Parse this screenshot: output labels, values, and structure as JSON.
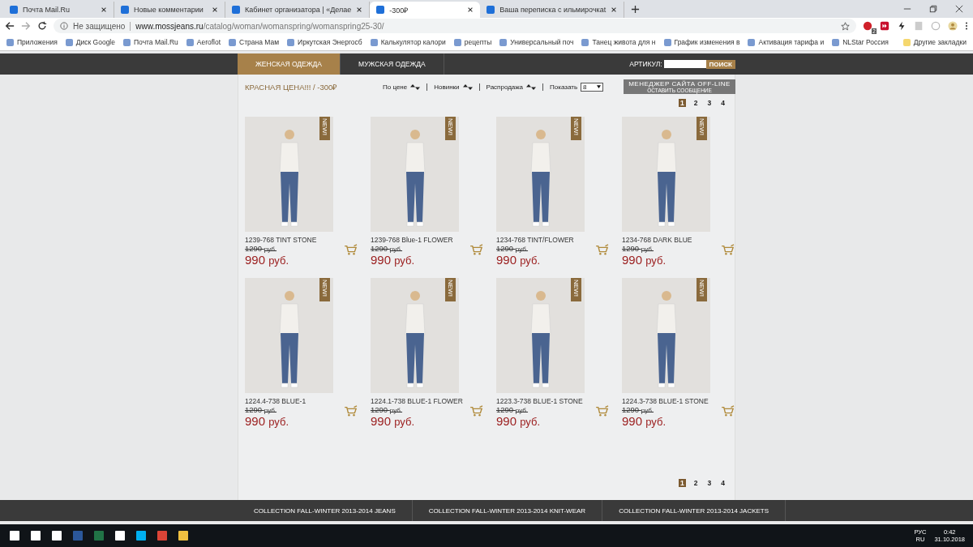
{
  "browser": {
    "tabs": [
      {
        "title": "Почта Mail.Ru",
        "selected": false
      },
      {
        "title": "Новые комментарии",
        "selected": false
      },
      {
        "title": "Кабинет организатора | «Делае",
        "selected": false
      },
      {
        "title": "-300₽",
        "selected": true
      },
      {
        "title": "Ваша переписка с ильмирочкаt",
        "selected": false
      }
    ],
    "security": "Не защищено",
    "url_host": "www.mossjeans.ru",
    "url_path": "/catalog/woman/womanspring/womanspring25-30/",
    "bookmarks": [
      "Приложения",
      "Диск Google",
      "Почта Mail.Ru",
      "Aeroflot",
      "Страна Мам",
      "Иркутская Энергосб",
      "Калькулятор калори",
      "рецепты",
      "Универсальный поч",
      "Танец живота для н",
      "График изменения в",
      "Активация тарифа и",
      "NLStar Россия"
    ],
    "other_bookmarks": "Другие закладки",
    "extension_badge": "2"
  },
  "site": {
    "nav": [
      {
        "label": "ЖЕНСКАЯ ОДЕЖДА",
        "selected": true
      },
      {
        "label": "МУЖСКАЯ ОДЕЖДА",
        "selected": false
      }
    ],
    "article_label": "АРТИКУЛ:",
    "search_button": "ПОИСК",
    "heading": "КРАСНАЯ ЦЕНА!!! / -300₽",
    "sort": [
      "По цене",
      "Новинки",
      "Распродажа"
    ],
    "show_label": "Показать",
    "show_value": "8",
    "manager": {
      "title": "МЕНЕДЖЕР САЙТА OFF-LINE",
      "subtitle": "ОСТАВИТЬ СООБЩЕНИЕ"
    },
    "pages": [
      {
        "label": "1",
        "selected": true
      },
      {
        "label": "2",
        "selected": false
      },
      {
        "label": "3",
        "selected": false
      },
      {
        "label": "4",
        "selected": false
      }
    ],
    "bottom_pages": [
      {
        "label": "1",
        "selected": true
      },
      {
        "label": "2",
        "selected": false
      },
      {
        "label": "3",
        "selected": false
      },
      {
        "label": "4",
        "selected": false
      }
    ],
    "products": [
      {
        "name": "1239-768 TINT STONE",
        "old_price": "1290",
        "old_unit": "руб.",
        "price": "990",
        "unit": "руб.",
        "badge": "NEW!"
      },
      {
        "name": "1239-768 Blue-1 FLOWER",
        "old_price": "1290",
        "old_unit": "руб.",
        "price": "990",
        "unit": "руб.",
        "badge": "NEW!"
      },
      {
        "name": "1234-768 TINT/FLOWER",
        "old_price": "1290",
        "old_unit": "руб.",
        "price": "990",
        "unit": "руб.",
        "badge": "NEW!"
      },
      {
        "name": "1234-768 DARK BLUE",
        "old_price": "1290",
        "old_unit": "руб.",
        "price": "990",
        "unit": "руб.",
        "badge": "NEW!"
      },
      {
        "name": "1224.4-738 BLUE-1",
        "old_price": "1290",
        "old_unit": "руб.",
        "price": "990",
        "unit": "руб.",
        "badge": "NEW!"
      },
      {
        "name": "1224.1-738 BLUE-1 FLOWER",
        "old_price": "1290",
        "old_unit": "руб.",
        "price": "990",
        "unit": "руб.",
        "badge": "NEW!"
      },
      {
        "name": "1223.3-738 BLUE-1 STONE",
        "old_price": "1290",
        "old_unit": "руб.",
        "price": "990",
        "unit": "руб.",
        "badge": "NEW!"
      },
      {
        "name": "1224.3-738 BLUE-1 STONE",
        "old_price": "1290",
        "old_unit": "руб.",
        "price": "990",
        "unit": "руб.",
        "badge": "NEW!"
      }
    ],
    "footer_links": [
      "COLLECTION FALL-WINTER 2013-2014 JEANS",
      "COLLECTION FALL-WINTER 2013-2014 KNIT-WEAR",
      "COLLECTION FALL-WINTER 2013-2014 JACKETS"
    ]
  },
  "taskbar": {
    "language": "РУС",
    "locale": "RU",
    "time": "0:42",
    "date": "31.10.2018"
  }
}
